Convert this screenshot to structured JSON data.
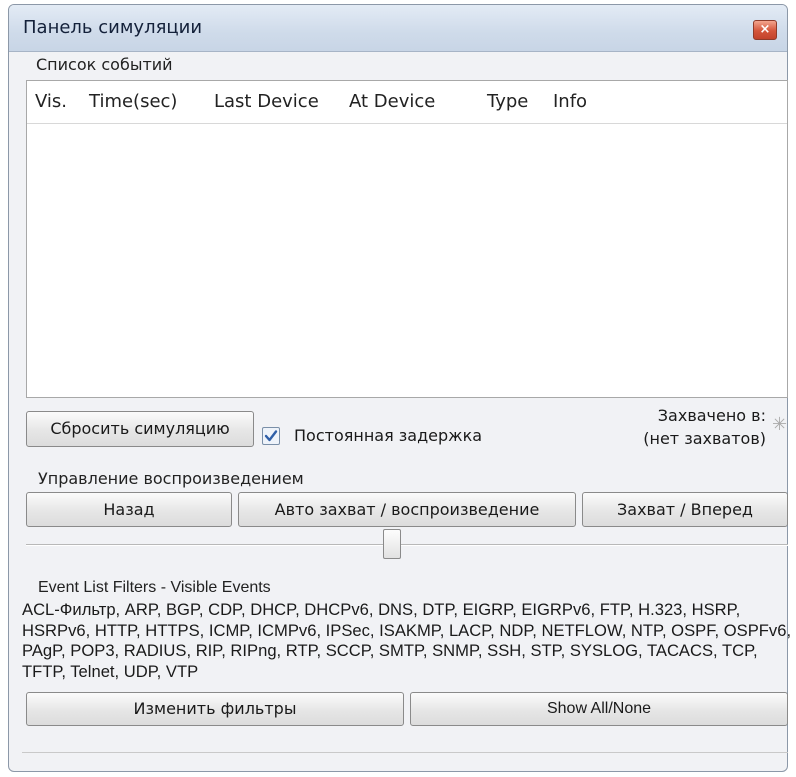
{
  "window": {
    "title": "Панель симуляции",
    "close_glyph": "×"
  },
  "event_list": {
    "caption": "Список событий",
    "columns": [
      "Vis.",
      "Time(sec)",
      "Last Device",
      "At Device",
      "Type",
      "Info"
    ],
    "rows": []
  },
  "controls": {
    "reset_label": "Сбросить симуляцию",
    "constant_delay_label": "Постоянная задержка",
    "constant_delay_checked": true,
    "captured_to_label": "Захвачено в:",
    "captured_to_value": "(нет захватов)",
    "captured_icon": "asterisk-icon"
  },
  "playback": {
    "caption": "Управление воспроизведением",
    "back_label": "Назад",
    "auto_label": "Авто захват / воспроизведение",
    "forward_label": "Захват / Вперед",
    "speed_slider_level": 0.5
  },
  "filters": {
    "caption": "Event List Filters - Visible Events",
    "visible_events": "ACL-Фильтр, ARP, BGP, CDP, DHCP, DHCPv6, DNS, DTP, EIGRP, EIGRPv6, FTP, H.323, HSRP, HSRPv6, HTTP, HTTPS, ICMP, ICMPv6, IPSec, ISAKMP, LACP, NDP, NETFLOW, NTP, OSPF, OSPFv6, PAgP, POP3, RADIUS, RIP, RIPng, RTP, SCCP, SMTP, SNMP, SSH, STP, SYSLOG, TACACS, TCP, TFTP, Telnet, UDP, VTP",
    "edit_label": "Изменить фильтры",
    "show_all_label": "Show All/None"
  },
  "colors": {
    "titlebar": "#cfdbea",
    "close_button": "#d4553a",
    "panel_bg": "#f0f0f0",
    "checkbox_check": "#2f5fa8"
  }
}
